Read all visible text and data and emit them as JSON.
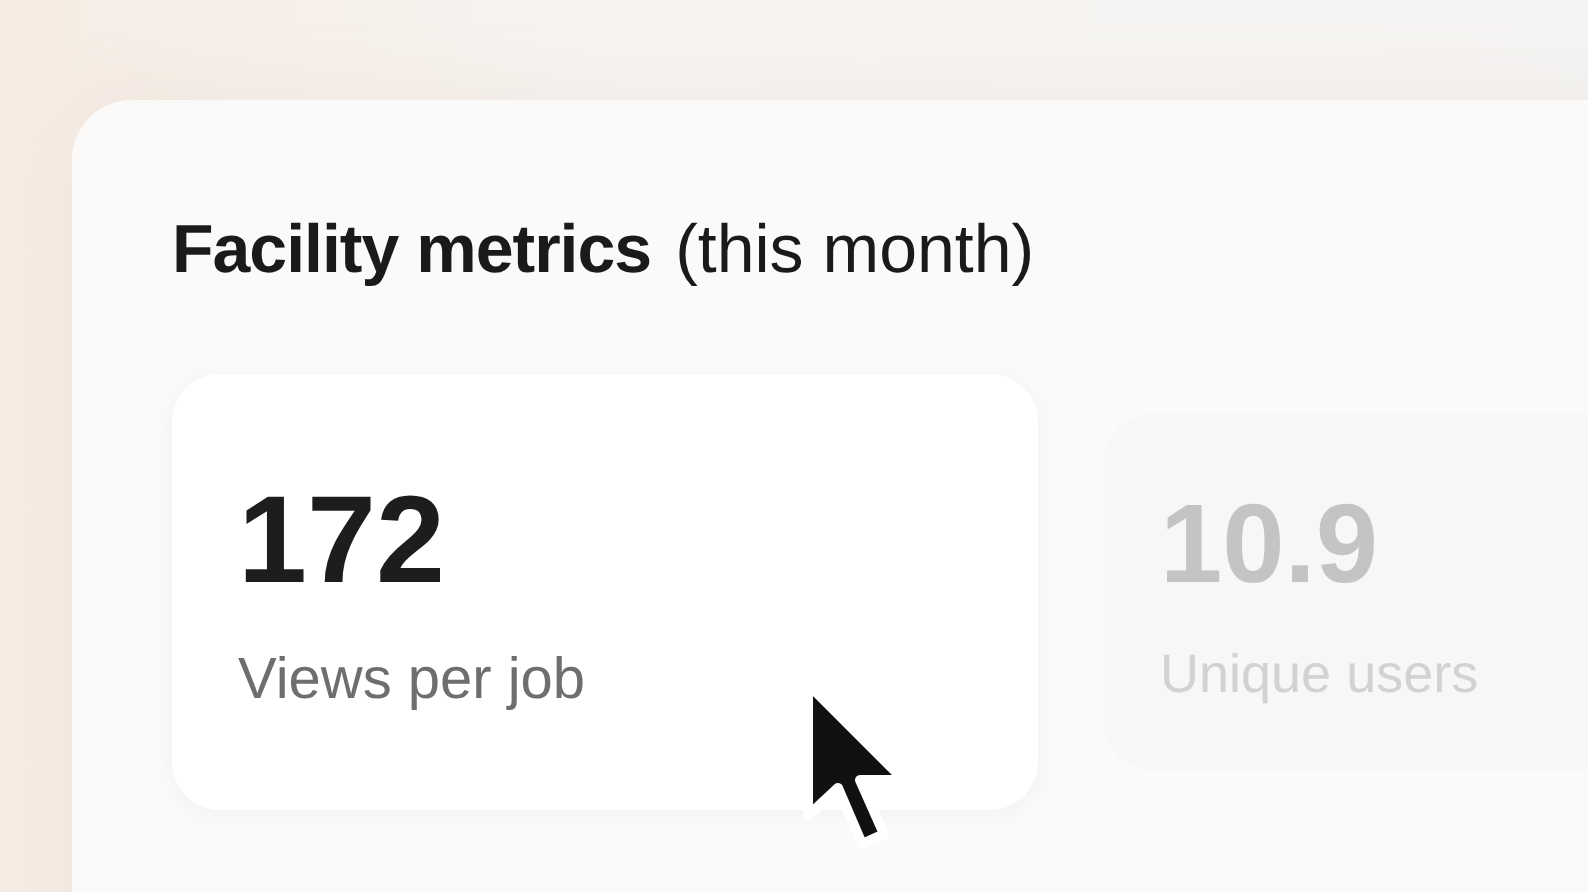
{
  "panel": {
    "title": "Facility metrics",
    "subtitle": "(this month)"
  },
  "metrics": [
    {
      "value": "172",
      "label": "Views per job",
      "selected": true
    },
    {
      "value": "10.9",
      "label": "Unique users",
      "selected": false
    }
  ]
}
